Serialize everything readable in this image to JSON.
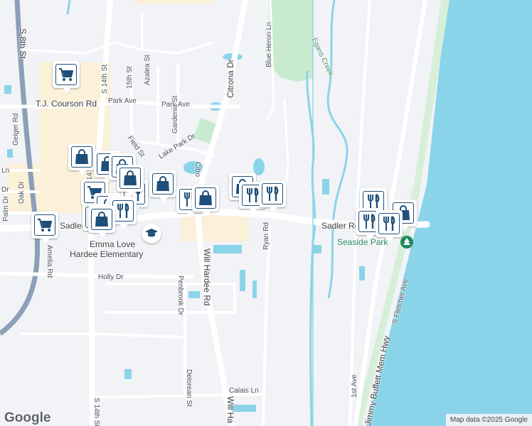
{
  "map": {
    "water_color": "#8ad4ea",
    "land_color": "#f2f3f6",
    "road_color": "#ffffff",
    "highway_color": "#8b9fb8",
    "commercial_color": "#fbf0d8",
    "park_color": "#c8ebd0"
  },
  "streets": {
    "s8th": "S 8th St",
    "s14th_north": "S 14th St",
    "s14th_south": "S 14th St",
    "s14th_mid": "14",
    "s15th": "15th St",
    "azalea": "Azalea St",
    "tj_courson": "T.J. Courson Rd",
    "park_ave_w": "Park Ave",
    "park_ave_e": "Park Ave",
    "citrona": "Citrona Dr",
    "citro": "Citro",
    "blue_heron": "Blue Heron Ln",
    "egans_creek": "Egans Creek",
    "gardenia": "Gardenia St",
    "field": "Field St",
    "lake_park": "Lake Park Dr",
    "geiger": "Geiger Rd",
    "oak": "Oak Dr",
    "palm": "Palm Dr",
    "ln": "Ln",
    "dr": "Dr",
    "sadler_w": "Sadler Ro",
    "sadler_e": "Sadler Ro",
    "amelia": "Amelia Rd",
    "ryan": "Ryan Rd",
    "holly": "Holly Dr",
    "penbrook": "Penbrook Dr",
    "will_hardee": "Will Hardee Rd",
    "will_h_south": "Will Ha",
    "delorean": "Delorean St",
    "calais": "Calais Ln",
    "first_ave": "1st Ave",
    "jimmy_buffett": "Jimmy Buffett Mem Hwy",
    "s_fletcher": "S Fletcher Ave"
  },
  "places": {
    "school_name_1": "Emma Love",
    "school_name_2": "Hardee Elementary",
    "park": "Seaside Park"
  },
  "pins": [
    {
      "kind": "cart",
      "icon": "shopping-cart-icon"
    },
    {
      "kind": "bag",
      "icon": "shopping-bag-icon"
    },
    {
      "kind": "cart",
      "icon": "shopping-cart-icon"
    },
    {
      "kind": "bag",
      "icon": "shopping-bag-icon"
    },
    {
      "kind": "bag",
      "icon": "shopping-bag-icon"
    },
    {
      "kind": "cart",
      "icon": "shopping-cart-icon"
    },
    {
      "kind": "fork",
      "icon": "restaurant-icon"
    },
    {
      "kind": "bag",
      "icon": "shopping-bag-icon"
    },
    {
      "kind": "bag",
      "icon": "shopping-bag-icon"
    },
    {
      "kind": "bag",
      "icon": "shopping-bag-icon"
    },
    {
      "kind": "fork",
      "icon": "restaurant-icon"
    },
    {
      "kind": "cart",
      "icon": "shopping-cart-icon"
    },
    {
      "kind": "bag",
      "icon": "shopping-bag-icon"
    },
    {
      "kind": "bag",
      "icon": "shopping-bag-icon"
    },
    {
      "kind": "fork",
      "icon": "restaurant-icon"
    },
    {
      "kind": "bag",
      "icon": "shopping-bag-icon"
    },
    {
      "kind": "bag",
      "icon": "shopping-bag-icon"
    },
    {
      "kind": "fork",
      "icon": "restaurant-icon"
    },
    {
      "kind": "fork",
      "icon": "restaurant-icon"
    },
    {
      "kind": "fork",
      "icon": "restaurant-icon"
    },
    {
      "kind": "fork",
      "icon": "restaurant-icon"
    },
    {
      "kind": "bag",
      "icon": "shopping-bag-icon"
    },
    {
      "kind": "fork",
      "icon": "restaurant-icon"
    }
  ],
  "footer": {
    "logo": "Google",
    "attribution": "Map data ©2025 Google"
  }
}
